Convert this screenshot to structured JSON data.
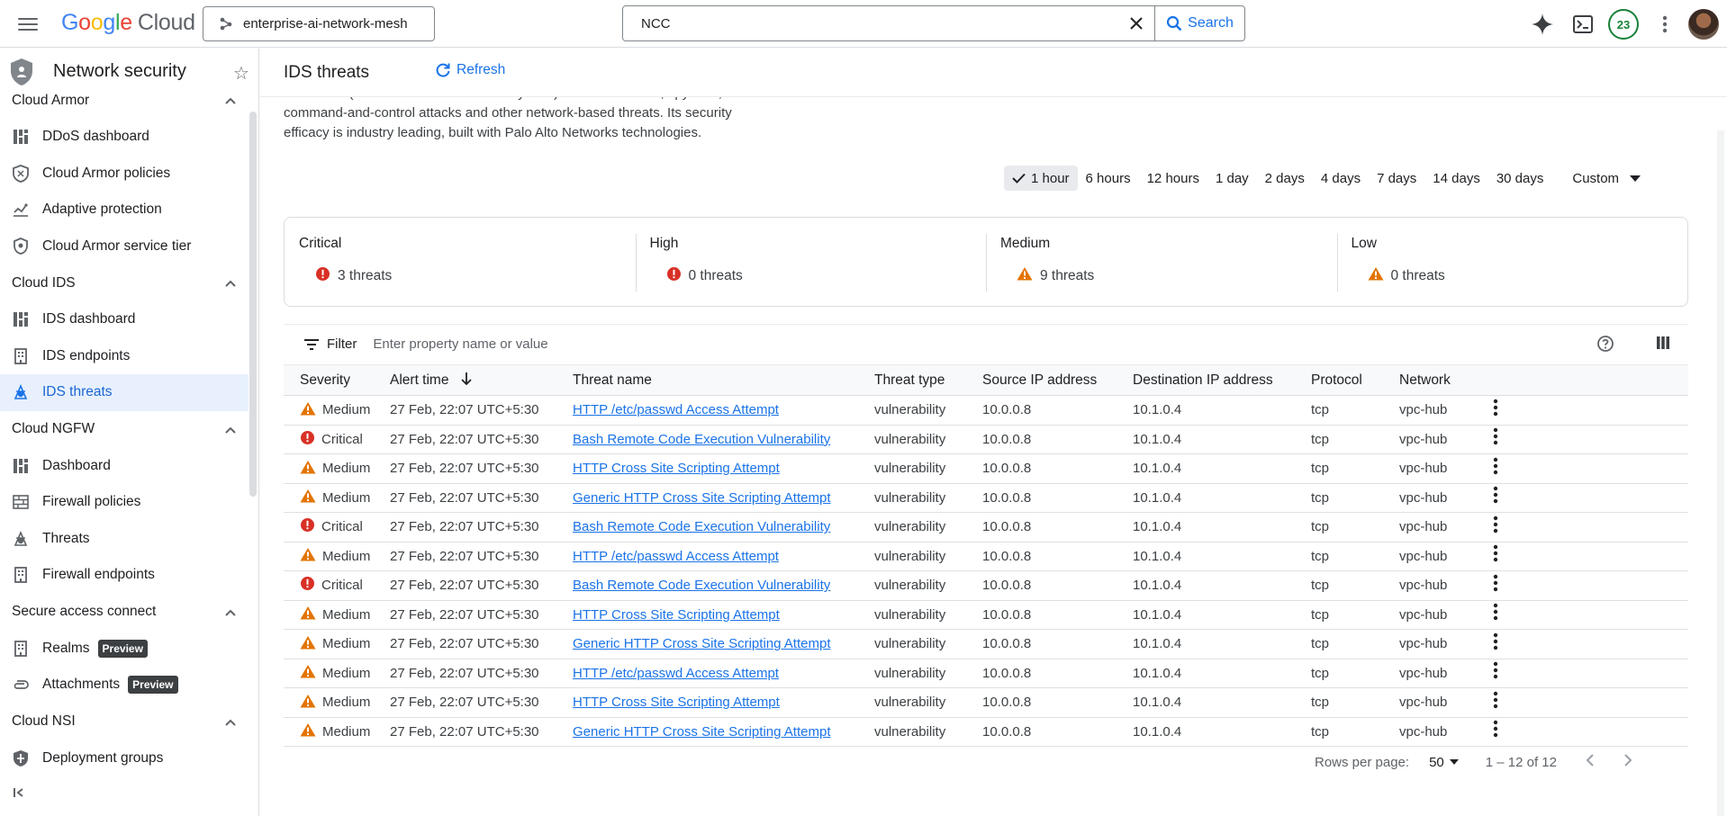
{
  "brand": {
    "logo_google": "Google",
    "logo_cloud": "Cloud"
  },
  "header": {
    "project": "enterprise-ai-network-mesh",
    "search_value": "NCC",
    "search_button": "Search",
    "notification_count": "23"
  },
  "sidebar": {
    "title": "Network security",
    "sections": [
      {
        "label": "Cloud Armor",
        "items": [
          {
            "label": "DDoS dashboard",
            "icon": "dashboard-icon"
          },
          {
            "label": "Cloud Armor policies",
            "icon": "shield-policy-icon"
          },
          {
            "label": "Adaptive protection",
            "icon": "analytics-icon"
          },
          {
            "label": "Cloud Armor service tier",
            "icon": "shield-icon"
          }
        ]
      },
      {
        "label": "Cloud IDS",
        "items": [
          {
            "label": "IDS dashboard",
            "icon": "dashboard-icon"
          },
          {
            "label": "IDS endpoints",
            "icon": "building-icon"
          },
          {
            "label": "IDS threats",
            "icon": "bug-icon",
            "active": true
          }
        ]
      },
      {
        "label": "Cloud NGFW",
        "items": [
          {
            "label": "Dashboard",
            "icon": "dashboard-icon"
          },
          {
            "label": "Firewall policies",
            "icon": "firewall-icon"
          },
          {
            "label": "Threats",
            "icon": "bug-icon"
          },
          {
            "label": "Firewall endpoints",
            "icon": "building-icon"
          }
        ]
      },
      {
        "label": "Secure access connect",
        "items": [
          {
            "label": "Realms",
            "icon": "building-icon",
            "tag": "Preview"
          },
          {
            "label": "Attachments",
            "icon": "attachment-icon",
            "tag": "Preview"
          }
        ]
      },
      {
        "label": "Cloud NSI",
        "items": [
          {
            "label": "Deployment groups",
            "icon": "shield-group-icon"
          }
        ]
      }
    ]
  },
  "page": {
    "title": "IDS threats",
    "refresh_label": "Refresh",
    "intro_line1": "Cloud IDS (Cloud Intrusion Detection System) detects malware, spyware,",
    "intro_line2": "command-and-control attacks and other network-based threats. Its security",
    "intro_line3": "efficacy is industry leading, built with Palo Alto Networks technologies."
  },
  "time_range": {
    "options": [
      "1 hour",
      "6 hours",
      "12 hours",
      "1 day",
      "2 days",
      "4 days",
      "7 days",
      "14 days",
      "30 days"
    ],
    "selected": "1 hour",
    "custom": "Custom"
  },
  "severity_summary": [
    {
      "label": "Critical",
      "count": "3 threats",
      "icon": "error-icon",
      "color": "#d93025"
    },
    {
      "label": "High",
      "count": "0 threats",
      "icon": "error-icon",
      "color": "#d93025"
    },
    {
      "label": "Medium",
      "count": "9 threats",
      "icon": "warning-icon",
      "color": "#e37400"
    },
    {
      "label": "Low",
      "count": "0 threats",
      "icon": "warning-icon",
      "color": "#e37400"
    }
  ],
  "filter": {
    "label": "Filter",
    "placeholder": "Enter property name or value"
  },
  "table": {
    "columns": [
      "Severity",
      "Alert time",
      "Threat name",
      "Threat type",
      "Source IP address",
      "Destination IP address",
      "Protocol",
      "Network"
    ],
    "rows": [
      {
        "severity": "Medium",
        "time": "27 Feb, 22:07 UTC+5:30",
        "name": "HTTP /etc/passwd Access Attempt",
        "type": "vulnerability",
        "src": "10.0.0.8",
        "dst": "10.1.0.4",
        "proto": "tcp",
        "net": "vpc-hub"
      },
      {
        "severity": "Critical",
        "time": "27 Feb, 22:07 UTC+5:30",
        "name": "Bash Remote Code Execution Vulnerability",
        "type": "vulnerability",
        "src": "10.0.0.8",
        "dst": "10.1.0.4",
        "proto": "tcp",
        "net": "vpc-hub"
      },
      {
        "severity": "Medium",
        "time": "27 Feb, 22:07 UTC+5:30",
        "name": "HTTP Cross Site Scripting Attempt",
        "type": "vulnerability",
        "src": "10.0.0.8",
        "dst": "10.1.0.4",
        "proto": "tcp",
        "net": "vpc-hub"
      },
      {
        "severity": "Medium",
        "time": "27 Feb, 22:07 UTC+5:30",
        "name": "Generic HTTP Cross Site Scripting Attempt",
        "type": "vulnerability",
        "src": "10.0.0.8",
        "dst": "10.1.0.4",
        "proto": "tcp",
        "net": "vpc-hub"
      },
      {
        "severity": "Critical",
        "time": "27 Feb, 22:07 UTC+5:30",
        "name": "Bash Remote Code Execution Vulnerability",
        "type": "vulnerability",
        "src": "10.0.0.8",
        "dst": "10.1.0.4",
        "proto": "tcp",
        "net": "vpc-hub"
      },
      {
        "severity": "Medium",
        "time": "27 Feb, 22:07 UTC+5:30",
        "name": "HTTP /etc/passwd Access Attempt",
        "type": "vulnerability",
        "src": "10.0.0.8",
        "dst": "10.1.0.4",
        "proto": "tcp",
        "net": "vpc-hub"
      },
      {
        "severity": "Critical",
        "time": "27 Feb, 22:07 UTC+5:30",
        "name": "Bash Remote Code Execution Vulnerability",
        "type": "vulnerability",
        "src": "10.0.0.8",
        "dst": "10.1.0.4",
        "proto": "tcp",
        "net": "vpc-hub"
      },
      {
        "severity": "Medium",
        "time": "27 Feb, 22:07 UTC+5:30",
        "name": "HTTP Cross Site Scripting Attempt",
        "type": "vulnerability",
        "src": "10.0.0.8",
        "dst": "10.1.0.4",
        "proto": "tcp",
        "net": "vpc-hub"
      },
      {
        "severity": "Medium",
        "time": "27 Feb, 22:07 UTC+5:30",
        "name": "Generic HTTP Cross Site Scripting Attempt",
        "type": "vulnerability",
        "src": "10.0.0.8",
        "dst": "10.1.0.4",
        "proto": "tcp",
        "net": "vpc-hub"
      },
      {
        "severity": "Medium",
        "time": "27 Feb, 22:07 UTC+5:30",
        "name": "HTTP /etc/passwd Access Attempt",
        "type": "vulnerability",
        "src": "10.0.0.8",
        "dst": "10.1.0.4",
        "proto": "tcp",
        "net": "vpc-hub"
      },
      {
        "severity": "Medium",
        "time": "27 Feb, 22:07 UTC+5:30",
        "name": "HTTP Cross Site Scripting Attempt",
        "type": "vulnerability",
        "src": "10.0.0.8",
        "dst": "10.1.0.4",
        "proto": "tcp",
        "net": "vpc-hub"
      },
      {
        "severity": "Medium",
        "time": "27 Feb, 22:07 UTC+5:30",
        "name": "Generic HTTP Cross Site Scripting Attempt",
        "type": "vulnerability",
        "src": "10.0.0.8",
        "dst": "10.1.0.4",
        "proto": "tcp",
        "net": "vpc-hub"
      }
    ]
  },
  "pagination": {
    "rows_per_page_label": "Rows per page:",
    "rows_per_page": "50",
    "range": "1 – 12 of 12"
  },
  "colors": {
    "accent": "#1a73e8",
    "critical": "#d93025",
    "medium": "#e37400",
    "active_bg": "#e8f0fe"
  }
}
